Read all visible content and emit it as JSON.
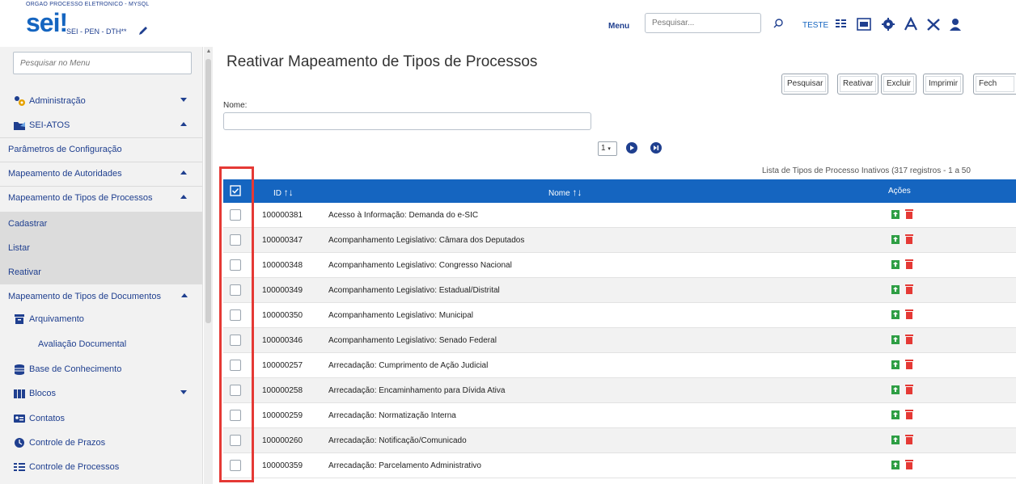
{
  "header": {
    "org": "ORGAO PROCESSO ELETRONICO - MYSQL",
    "logo": "sei",
    "logo_bang": "!",
    "subtitle": "SEI - PEN - DTH**",
    "menu_label": "Menu",
    "search_placeholder": "Pesquisar...",
    "user": "TESTE",
    "icons": [
      "pencil-icon",
      "search-icon",
      "grid-icon",
      "calendar-icon",
      "gear-icon",
      "font-size-icon",
      "tools-icon",
      "user-icon"
    ]
  },
  "sidebar": {
    "search_placeholder": "Pesquisar no Menu",
    "items": [
      {
        "label": "Administração",
        "icon": "gears-icon",
        "caret": "down"
      },
      {
        "label": "SEI-ATOS",
        "icon": "folder-icon",
        "caret": "up"
      },
      {
        "label": "Parâmetros de Configuração"
      },
      {
        "label": "Mapeamento de Autoridades",
        "caret": "up"
      },
      {
        "label": "Mapeamento de Tipos de Processos",
        "caret": "up"
      },
      {
        "label": "Cadastrar"
      },
      {
        "label": "Listar"
      },
      {
        "label": "Reativar"
      },
      {
        "label": "Mapeamento de Tipos de Documentos",
        "caret": "up"
      },
      {
        "label": "Arquivamento",
        "icon": "archive-icon"
      },
      {
        "label": "Avaliação Documental"
      },
      {
        "label": "Base de Conhecimento",
        "icon": "database-icon"
      },
      {
        "label": "Blocos",
        "icon": "books-icon",
        "caret": "down"
      },
      {
        "label": "Contatos",
        "icon": "contact-card-icon"
      },
      {
        "label": "Controle de Prazos",
        "icon": "clock-icon"
      },
      {
        "label": "Controle de Processos",
        "icon": "list-icon"
      }
    ]
  },
  "main": {
    "title": "Reativar Mapeamento de Tipos de Processos",
    "buttons": [
      "Pesquisar",
      "Reativar",
      "Excluir",
      "Imprimir",
      "Fech"
    ],
    "nome_label": "Nome:",
    "page_number": "1",
    "list_caption": "Lista de Tipos de Processo Inativos (317 registros - 1 a 50",
    "columns": {
      "id": "ID",
      "nome": "Nome",
      "acoes": "Ações"
    },
    "rows": [
      {
        "id": "100000381",
        "nome": "Acesso à Informação: Demanda do e-SIC"
      },
      {
        "id": "100000347",
        "nome": "Acompanhamento Legislativo: Câmara dos Deputados"
      },
      {
        "id": "100000348",
        "nome": "Acompanhamento Legislativo: Congresso Nacional"
      },
      {
        "id": "100000349",
        "nome": "Acompanhamento Legislativo: Estadual/Distrital"
      },
      {
        "id": "100000350",
        "nome": "Acompanhamento Legislativo: Municipal"
      },
      {
        "id": "100000346",
        "nome": "Acompanhamento Legislativo: Senado Federal"
      },
      {
        "id": "100000257",
        "nome": "Arrecadação: Cumprimento de Ação Judicial"
      },
      {
        "id": "100000258",
        "nome": "Arrecadação: Encaminhamento para Dívida Ativa"
      },
      {
        "id": "100000259",
        "nome": "Arrecadação: Normatização Interna"
      },
      {
        "id": "100000260",
        "nome": "Arrecadação: Notificação/Comunicado"
      },
      {
        "id": "100000359",
        "nome": "Arrecadação: Parcelamento Administrativo"
      }
    ]
  },
  "colors": {
    "primary": "#1565c0",
    "nav_text": "#1f3f8f",
    "reactivate": "#2e9e44",
    "delete": "#e53935",
    "highlight": "#e53935"
  }
}
